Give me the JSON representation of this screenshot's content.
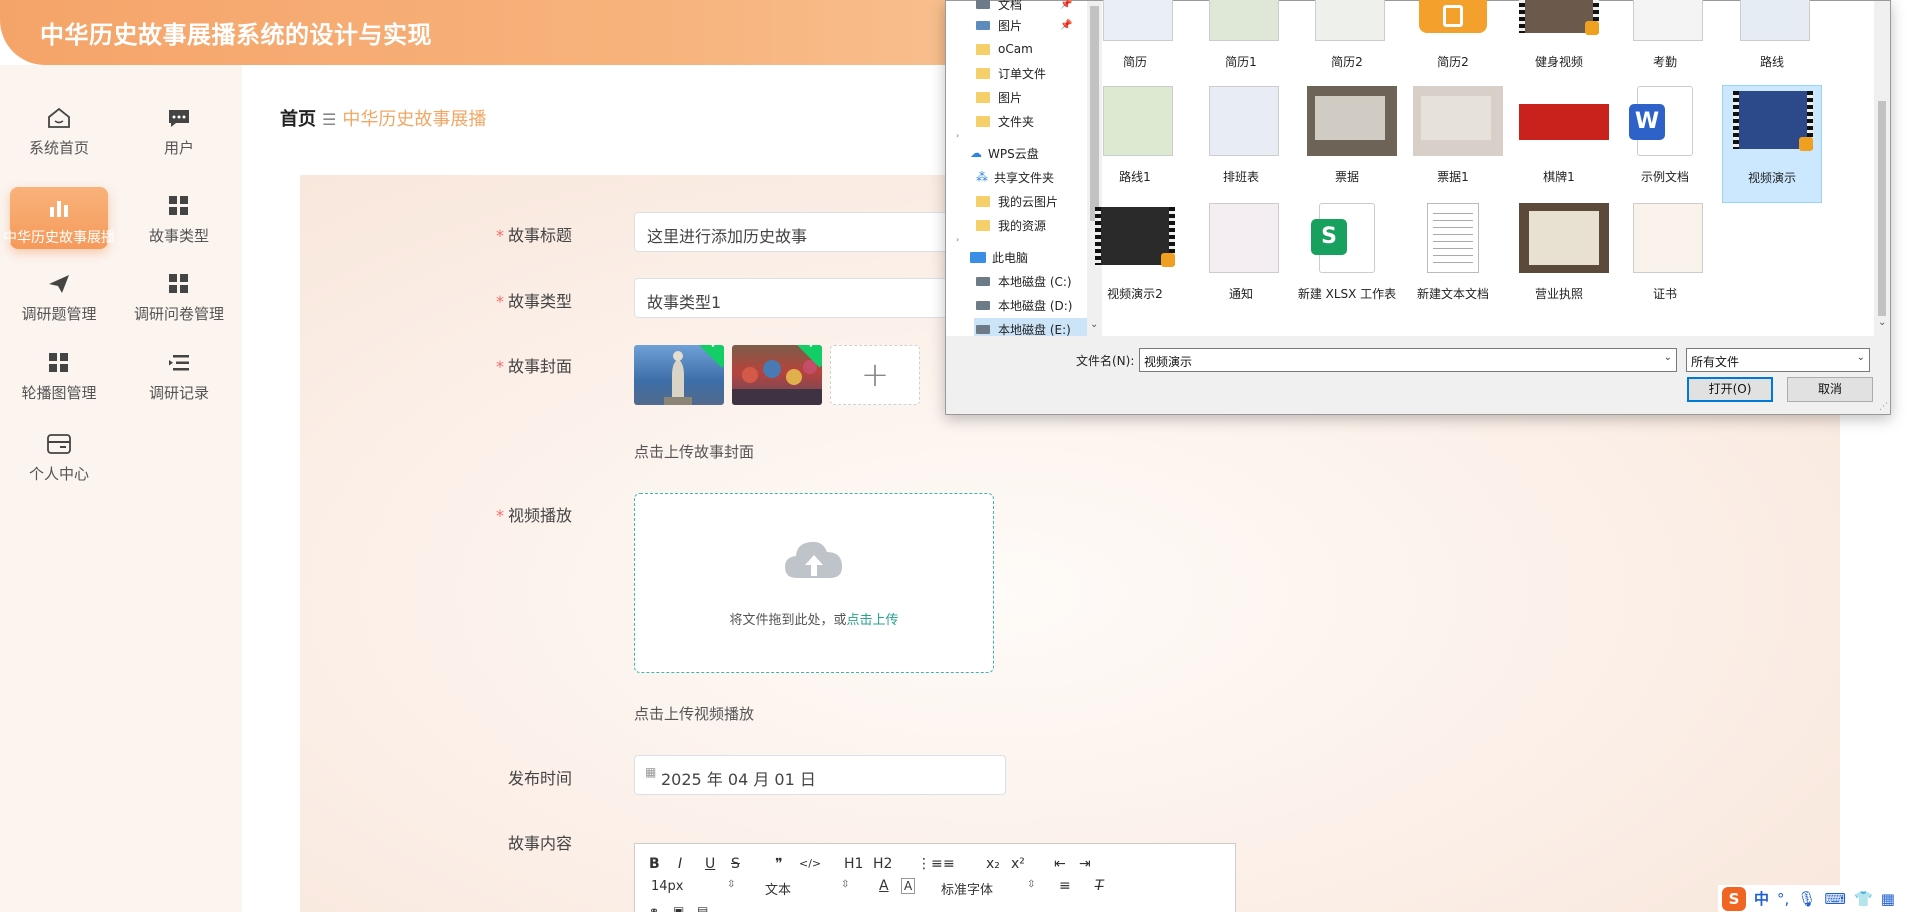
{
  "app": {
    "title": "中华历史故事展播系统的设计与实现"
  },
  "sidebar": {
    "items": [
      {
        "label": "系统首页"
      },
      {
        "label": "用户"
      },
      {
        "label": "中华历史故事展播"
      },
      {
        "label": "故事类型"
      },
      {
        "label": "调研题管理"
      },
      {
        "label": "调研问卷管理"
      },
      {
        "label": "轮播图管理"
      },
      {
        "label": "调研记录"
      },
      {
        "label": "个人中心"
      }
    ]
  },
  "breadcrumb": {
    "home": "首页",
    "current": "中华历史故事展播"
  },
  "form": {
    "title_label": "故事标题",
    "title_value": "这里进行添加历史故事",
    "type_label": "故事类型",
    "type_value": "故事类型1",
    "cover_label": "故事封面",
    "cover_add": "+",
    "cover_hint": "点击上传故事封面",
    "video_label": "视频播放",
    "video_drop_text": "将文件拖到此处，或",
    "video_drop_link": "点击上传",
    "video_hint": "点击上传视频播放",
    "date_label": "发布时间",
    "date_value": "2025 年 04 月 01 日",
    "content_label": "故事内容",
    "editor": {
      "font_size": "14px",
      "paragraph": "文本",
      "font_family": "标准字体",
      "buttons": [
        "B",
        "I",
        "U",
        "S",
        "❞",
        "</>",
        "H1",
        "H2",
        "⋮≡",
        "≡",
        "x₂",
        "x²",
        "⇤",
        "⇥"
      ]
    }
  },
  "dialog": {
    "tree": [
      {
        "label": "文档",
        "kind": "doc"
      },
      {
        "label": "图片",
        "kind": "pic"
      },
      {
        "label": "oCam",
        "kind": "folder"
      },
      {
        "label": "订单文件",
        "kind": "folder"
      },
      {
        "label": "图片",
        "kind": "folder"
      },
      {
        "label": "文件夹",
        "kind": "folder"
      },
      {
        "label": "WPS云盘",
        "kind": "cloud"
      },
      {
        "label": "共享文件夹",
        "kind": "share"
      },
      {
        "label": "我的云图片",
        "kind": "folder"
      },
      {
        "label": "我的资源",
        "kind": "folder"
      },
      {
        "label": "此电脑",
        "kind": "pc"
      },
      {
        "label": "本地磁盘 (C:)",
        "kind": "drive"
      },
      {
        "label": "本地磁盘 (D:)",
        "kind": "drive"
      },
      {
        "label": "本地磁盘 (E:)",
        "kind": "drive"
      }
    ],
    "files": [
      {
        "name": "简历",
        "thumb": "doc",
        "color": "#e9eef7"
      },
      {
        "name": "简历1",
        "thumb": "doc",
        "color": "#dfe8d6"
      },
      {
        "name": "简历2",
        "thumb": "tower",
        "color": "#eef0ec"
      },
      {
        "name": "简历2",
        "thumb": "zip",
        "color": "#f3a12c"
      },
      {
        "name": "健身视频",
        "thumb": "video",
        "color": "#6b5a4c"
      },
      {
        "name": "考勤",
        "thumb": "sheet",
        "color": "#f4f4f4"
      },
      {
        "name": "路线",
        "thumb": "map",
        "color": "#e5ecf4"
      },
      {
        "name": "路线1",
        "thumb": "map2",
        "color": "#dcead2"
      },
      {
        "name": "排班表",
        "thumb": "table",
        "color": "#e8edf5"
      },
      {
        "name": "票据",
        "thumb": "photo",
        "color": "#6d6357"
      },
      {
        "name": "票据1",
        "thumb": "photo2",
        "color": "#d8d0c8"
      },
      {
        "name": "棋牌1",
        "thumb": "banner",
        "color": "#c9221d"
      },
      {
        "name": "示例文档",
        "thumb": "word",
        "color": "#2f62c9"
      },
      {
        "name": "视频演示",
        "thumb": "video2",
        "color": "#2c4a8a"
      },
      {
        "name": "视频演示2",
        "thumb": "video3",
        "color": "#2a2a2a"
      },
      {
        "name": "通知",
        "thumb": "cert",
        "color": "#f4eef2"
      },
      {
        "name": "新建 XLSX 工作表",
        "thumb": "xlsx",
        "color": "#18a05e"
      },
      {
        "name": "新建文本文档",
        "thumb": "txt",
        "color": "#ffffff"
      },
      {
        "name": "营业执照",
        "thumb": "frame",
        "color": "#5b4a3a"
      },
      {
        "name": "证书",
        "thumb": "cert2",
        "color": "#faf3ec"
      }
    ],
    "filename_label": "文件名(N):",
    "filename_value": "视频演示",
    "filetype_value": "所有文件",
    "open_label": "打开(O)",
    "cancel_label": "取消"
  },
  "taskbar": {
    "ime": "中",
    "punct": "°,"
  }
}
